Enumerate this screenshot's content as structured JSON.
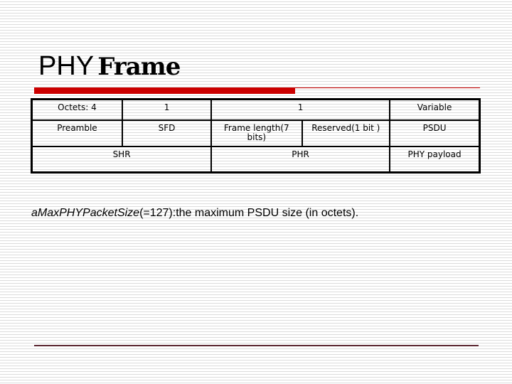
{
  "slide": {
    "title_part1": "PHY",
    "title_part2": "Frame",
    "colors": {
      "accent_bar": "#cc0000",
      "footer_line": "#5a2630"
    }
  },
  "frame_table": {
    "row_octets": {
      "shr_octets": "Octets: 4",
      "sfd_octets": "1",
      "phr_octets": "1",
      "psdu_octets": "Variable"
    },
    "row_fields": {
      "preamble": "Preamble",
      "sfd": "SFD",
      "frame_length": "Frame length(7 bits)",
      "reserved": "Reserved(1 bit )",
      "psdu": "PSDU"
    },
    "row_groups": {
      "shr": "SHR",
      "phr": "PHR",
      "payload": "PHY payload"
    }
  },
  "note": {
    "term": "aMaxPHYPacketSize",
    "text": "(=127):the maximum PSDU size (in octets)."
  }
}
